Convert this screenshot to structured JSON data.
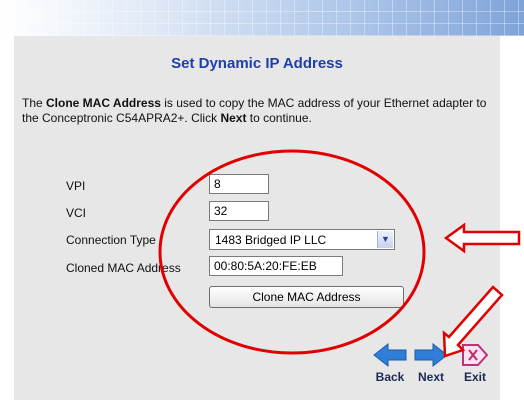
{
  "page": {
    "title": "Set Dynamic IP Address",
    "intro_pre": "The ",
    "intro_bold1": "Clone MAC Address",
    "intro_mid": " is used to copy the MAC address of your Ethernet adapter to the Conceptronic C54APRA2+. Click ",
    "intro_bold2": "Next",
    "intro_post": " to continue."
  },
  "form": {
    "vpi_label": "VPI",
    "vpi_value": "8",
    "vci_label": "VCI",
    "vci_value": "32",
    "conn_label": "Connection Type",
    "conn_value": "1483 Bridged IP LLC",
    "mac_label": "Cloned MAC Address",
    "mac_value": "00:80:5A:20:FE:EB",
    "clone_button": "Clone MAC Address"
  },
  "nav": {
    "back": "Back",
    "next": "Next",
    "exit": "Exit"
  },
  "colors": {
    "title": "#1f3fa8",
    "annotation": "#e00000",
    "nav_arrow": "#2f7fd8",
    "exit_icon": "#c0307a"
  }
}
